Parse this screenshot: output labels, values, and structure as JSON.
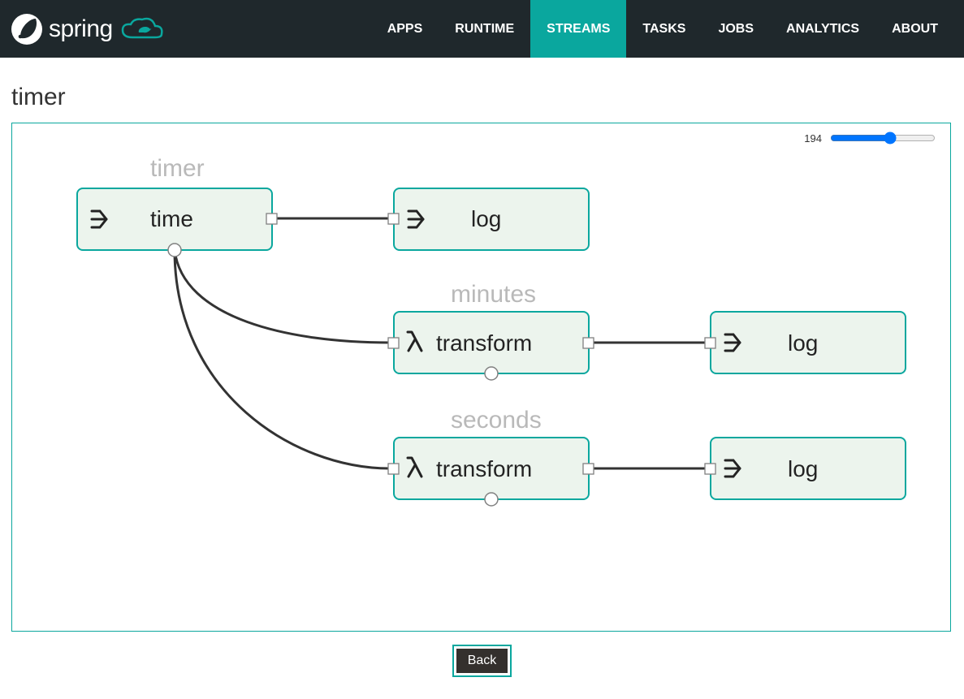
{
  "brand": {
    "name": "spring"
  },
  "nav": {
    "items": [
      {
        "label": "APPS"
      },
      {
        "label": "RUNTIME"
      },
      {
        "label": "STREAMS",
        "active": true
      },
      {
        "label": "TASKS"
      },
      {
        "label": "JOBS"
      },
      {
        "label": "ANALYTICS"
      },
      {
        "label": "ABOUT"
      }
    ]
  },
  "page": {
    "title": "timer"
  },
  "zoom": {
    "value": "194"
  },
  "streams": {
    "timer": {
      "title": "timer",
      "nodes": [
        "time",
        "log"
      ]
    },
    "minutes": {
      "title": "minutes",
      "nodes": [
        "transform",
        "log"
      ]
    },
    "seconds": {
      "title": "seconds",
      "nodes": [
        "transform",
        "log"
      ]
    }
  },
  "nodeLabels": {
    "time": "time",
    "log1": "log",
    "transform1": "transform",
    "log2": "log",
    "transform2": "transform",
    "log3": "log"
  },
  "footer": {
    "back_label": "Back"
  }
}
